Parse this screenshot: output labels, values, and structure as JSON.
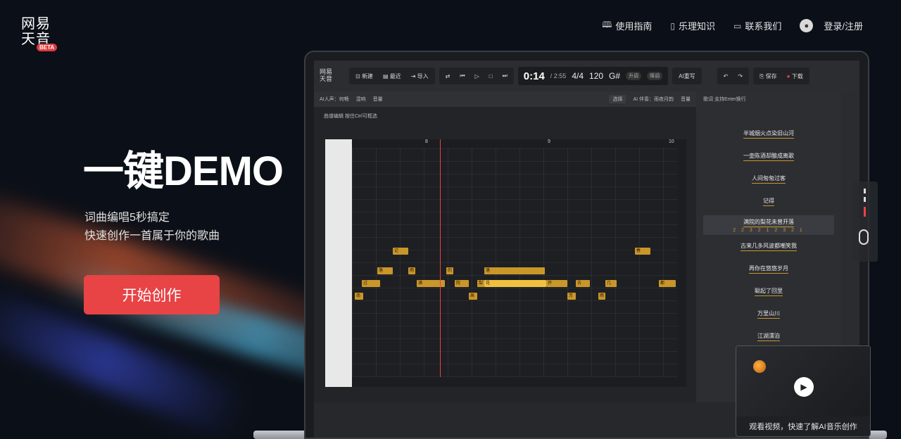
{
  "brand": {
    "line1": "网易",
    "line2": "天音",
    "badge": "BETA"
  },
  "nav": [
    {
      "icon": "book-icon",
      "label": "使用指南"
    },
    {
      "icon": "doc-icon",
      "label": "乐理知识"
    },
    {
      "icon": "chat-icon",
      "label": "联系我们"
    }
  ],
  "login": {
    "label": "登录/注册"
  },
  "hero": {
    "title": "一键DEMO",
    "sub1": "词曲编唱5秒搞定",
    "sub2": "快速创作一首属于你的歌曲",
    "cta": "开始创作"
  },
  "app": {
    "toolbar": {
      "new": "新建",
      "recent": "最近",
      "import": "导入",
      "time": "0:14",
      "duration": "/ 2:55",
      "meter": "4/4",
      "bpm": "120",
      "key": "G#",
      "ai_rewrite": "AI重写",
      "save": "保存",
      "download": "下载"
    },
    "subbar": {
      "voice": "AI人声：何畅",
      "mix": "混响",
      "volume": "音量",
      "select": "选择",
      "accomp": "AI 伴奏：雨夜月韵",
      "volume2": "音量"
    },
    "editor_head": "曲谱编辑 按住Ctrl可框选",
    "lyrics_head": "歌词 支持Enter换行",
    "ruler": [
      "8",
      "9",
      "10"
    ],
    "notes": [
      "记",
      "落",
      "雨",
      "的",
      "落",
      "过",
      "满",
      "院",
      "梨",
      "花",
      "开",
      "古",
      "几",
      "都",
      "南",
      "高",
      "芳",
      "雨",
      "春"
    ],
    "lyrics": [
      "半城烟火点染旧山河",
      "一壶陈酒却酿成离歌",
      "人间匆匆过客",
      "记得",
      "满院的梨花未曾开落",
      "古来几多风波都嘲笑我",
      "再你在悠悠岁月",
      "聪起了回里",
      "万里山川",
      "江湖漂泊"
    ],
    "numbers": "2 2 3 2 1 2 3 2 1"
  },
  "video": {
    "caption": "观看视频，快速了解AI音乐创作"
  }
}
